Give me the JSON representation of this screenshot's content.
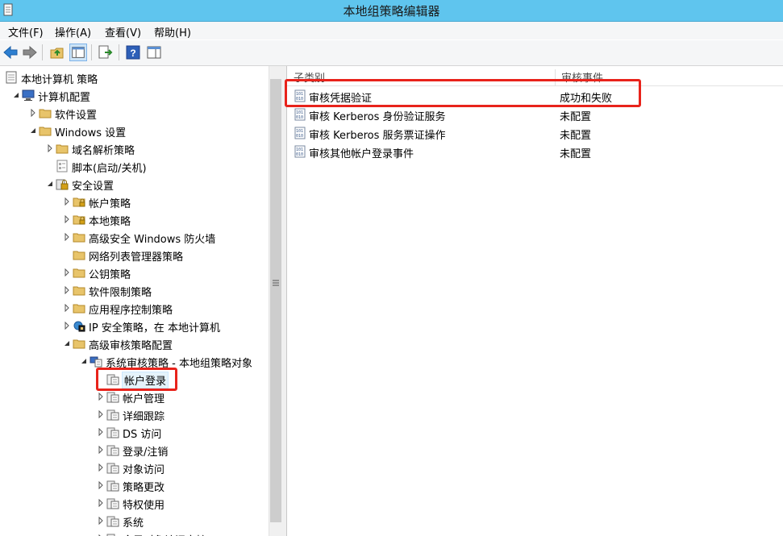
{
  "window": {
    "title": "本地组策略编辑器"
  },
  "menu": {
    "items": [
      "文件(F)",
      "操作(A)",
      "查看(V)",
      "帮助(H)"
    ]
  },
  "toolbar": {
    "buttons": [
      "back-icon",
      "forward-icon",
      "up-folder-icon",
      "show-tree-icon",
      "export-list-icon",
      "help-icon",
      "properties-view-icon"
    ]
  },
  "tree": {
    "items": [
      {
        "label": "本地计算机 策略",
        "level": 0,
        "arrow": "none",
        "icon": "policy-doc-icon"
      },
      {
        "label": "计算机配置",
        "level": 1,
        "arrow": "expanded",
        "icon": "computer-icon"
      },
      {
        "label": "软件设置",
        "level": 2,
        "arrow": "collapsed",
        "icon": "folder-icon"
      },
      {
        "label": "Windows 设置",
        "level": 2,
        "arrow": "expanded",
        "icon": "folder-icon"
      },
      {
        "label": "域名解析策略",
        "level": 3,
        "arrow": "collapsed",
        "icon": "folder-icon"
      },
      {
        "label": "脚本(启动/关机)",
        "level": 3,
        "arrow": "none",
        "icon": "script-icon"
      },
      {
        "label": "安全设置",
        "level": 3,
        "arrow": "expanded",
        "icon": "security-icon"
      },
      {
        "label": "帐户策略",
        "level": 4,
        "arrow": "collapsed",
        "icon": "locked-folder-icon"
      },
      {
        "label": "本地策略",
        "level": 4,
        "arrow": "collapsed",
        "icon": "locked-folder-icon"
      },
      {
        "label": "高级安全 Windows 防火墙",
        "level": 4,
        "arrow": "collapsed",
        "icon": "folder-icon"
      },
      {
        "label": "网络列表管理器策略",
        "level": 4,
        "arrow": "none",
        "icon": "folder-icon"
      },
      {
        "label": "公钥策略",
        "level": 4,
        "arrow": "collapsed",
        "icon": "folder-icon"
      },
      {
        "label": "软件限制策略",
        "level": 4,
        "arrow": "collapsed",
        "icon": "folder-icon"
      },
      {
        "label": "应用程序控制策略",
        "level": 4,
        "arrow": "collapsed",
        "icon": "folder-icon"
      },
      {
        "label": "IP 安全策略，在 本地计算机",
        "level": 4,
        "arrow": "collapsed",
        "icon": "ip-security-icon"
      },
      {
        "label": "高级审核策略配置",
        "level": 4,
        "arrow": "expanded",
        "icon": "folder-icon"
      },
      {
        "label": "系统审核策略 - 本地组策略对象",
        "level": 5,
        "arrow": "expanded",
        "icon": "audit-computer-icon"
      },
      {
        "label": "帐户登录",
        "level": 6,
        "arrow": "none",
        "icon": "audit-folder-icon",
        "selected": true
      },
      {
        "label": "帐户管理",
        "level": 6,
        "arrow": "collapsed",
        "icon": "audit-folder-icon"
      },
      {
        "label": "详细跟踪",
        "level": 6,
        "arrow": "collapsed",
        "icon": "audit-folder-icon"
      },
      {
        "label": "DS 访问",
        "level": 6,
        "arrow": "collapsed",
        "icon": "audit-folder-icon"
      },
      {
        "label": "登录/注销",
        "level": 6,
        "arrow": "collapsed",
        "icon": "audit-folder-icon"
      },
      {
        "label": "对象访问",
        "level": 6,
        "arrow": "collapsed",
        "icon": "audit-folder-icon"
      },
      {
        "label": "策略更改",
        "level": 6,
        "arrow": "collapsed",
        "icon": "audit-folder-icon"
      },
      {
        "label": "特权使用",
        "level": 6,
        "arrow": "collapsed",
        "icon": "audit-folder-icon"
      },
      {
        "label": "系统",
        "level": 6,
        "arrow": "collapsed",
        "icon": "audit-folder-icon"
      },
      {
        "label": "全局对象访问审核",
        "level": 6,
        "arrow": "collapsed",
        "icon": "audit-folder-icon"
      }
    ]
  },
  "list": {
    "columns": [
      "子类别",
      "审核事件"
    ],
    "rows": [
      {
        "name": "审核凭据验证",
        "value": "成功和失败"
      },
      {
        "name": "审核 Kerberos 身份验证服务",
        "value": "未配置"
      },
      {
        "name": "审核 Kerberos 服务票证操作",
        "value": "未配置"
      },
      {
        "name": "审核其他帐户登录事件",
        "value": "未配置"
      }
    ]
  },
  "colors": {
    "titlebar": "#5fc5ee",
    "highlight": "#e8231b",
    "folder": "#e8c46a"
  }
}
